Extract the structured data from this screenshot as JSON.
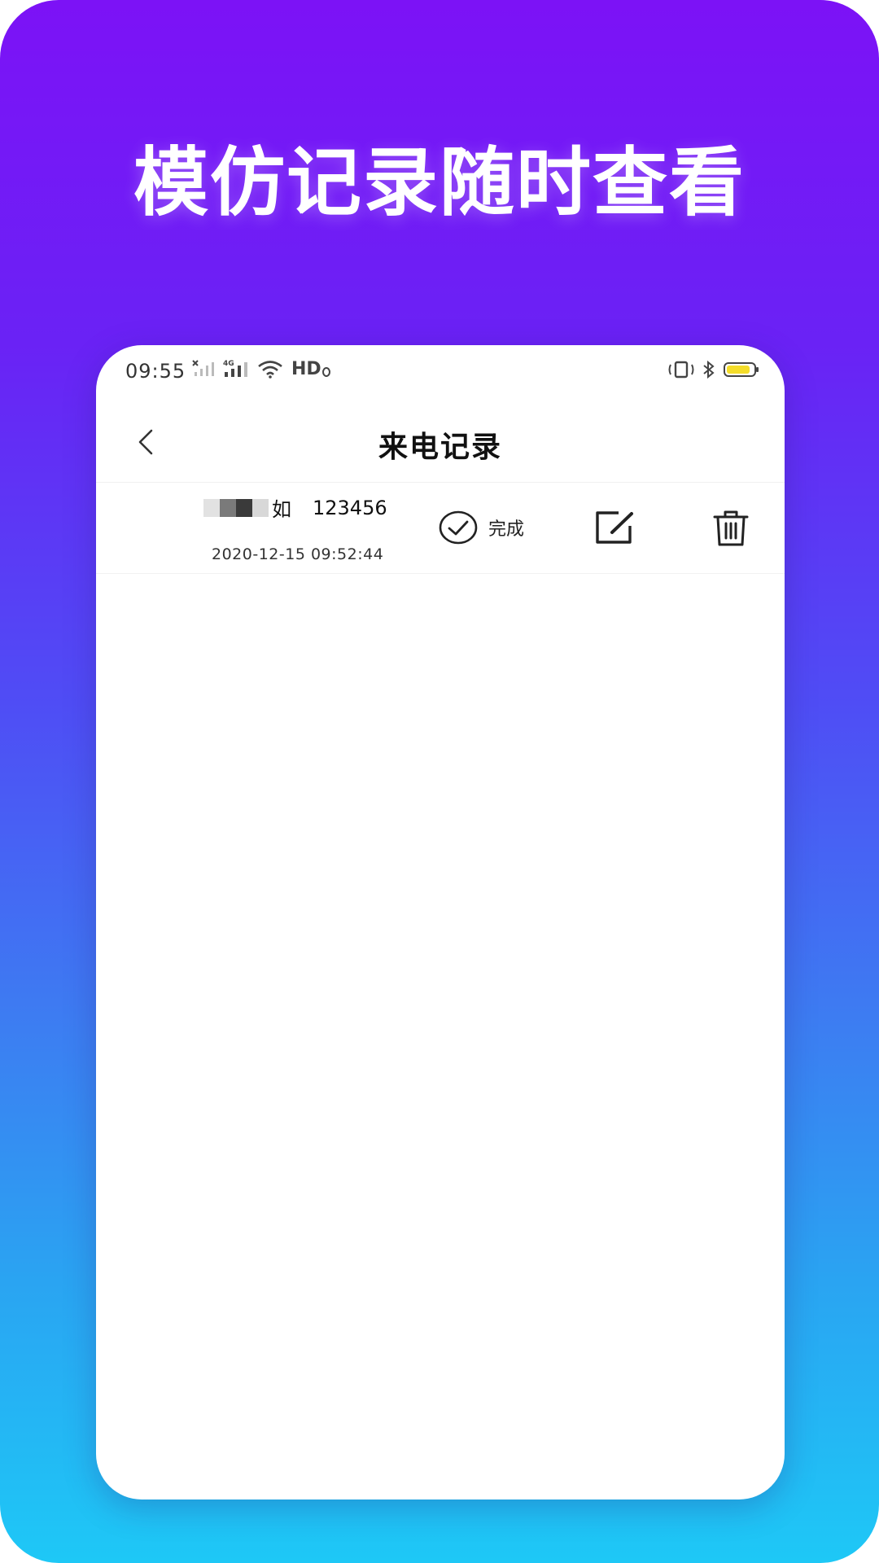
{
  "headline": "模仿记录随时查看",
  "status_bar": {
    "time": "09:55",
    "hd_label": "HD"
  },
  "nav": {
    "title": "来电记录",
    "back_icon": "chevron-left-icon"
  },
  "records": [
    {
      "caller_name": "如",
      "caller_number": "123456",
      "timestamp": "2020-12-15 09:52:44",
      "done_label": "完成"
    }
  ],
  "colors": {
    "gradient_top": "#7c12f6",
    "gradient_bottom": "#1ec8f6",
    "card_bg": "#ffffff",
    "battery_fill": "#f4dd2a"
  }
}
